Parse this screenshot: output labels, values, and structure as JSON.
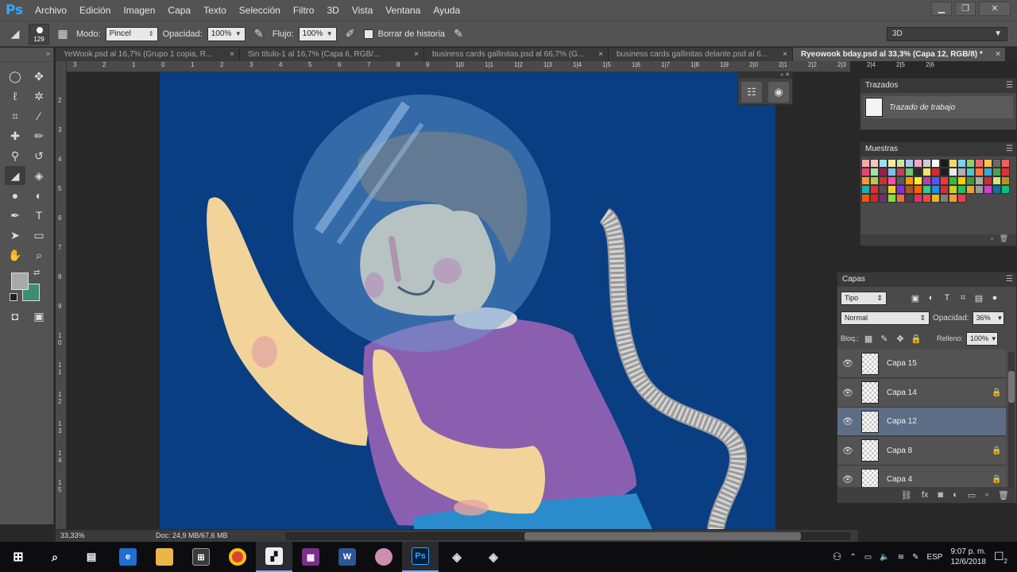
{
  "menu": {
    "logo": "Ps",
    "items": [
      "Archivo",
      "Edición",
      "Imagen",
      "Capa",
      "Texto",
      "Selección",
      "Filtro",
      "3D",
      "Vista",
      "Ventana",
      "Ayuda"
    ]
  },
  "window_controls": {
    "minimize": "▁",
    "restore": "❐",
    "close": "✕"
  },
  "options": {
    "brush_size": "129",
    "mode_label": "Modo:",
    "mode_value": "Pincel",
    "opacity_label": "Opacidad:",
    "opacity_value": "100%",
    "flow_label": "Flujo:",
    "flow_value": "100%",
    "erase_history_label": "Borrar de historia",
    "workspace": "3D"
  },
  "tabs": [
    {
      "label": "YeWook.psd al 16,7% (Grupo 1 copia, R...",
      "close": "×"
    },
    {
      "label": "Sin título-1 al 16,7% (Capa 6, RGB/...",
      "close": "×"
    },
    {
      "label": "business cards gallinitas.psd al 66,7% (G...",
      "close": "×"
    },
    {
      "label": "business cards gallinitas delante.psd al 6...",
      "close": "×"
    },
    {
      "label": "Ryeowook bday.psd al 33,3% (Capa 12, RGB/8) *",
      "close": "×"
    }
  ],
  "ruler_top": [
    "3",
    "2",
    "1",
    "0",
    "1",
    "2",
    "3",
    "4",
    "5",
    "6",
    "7",
    "8",
    "9",
    "1|0",
    "1|1",
    "1|2",
    "1|3",
    "1|4",
    "1|5",
    "1|6",
    "1|7",
    "1|8",
    "1|9",
    "2|0",
    "2|1",
    "2|2",
    "2|3",
    "2|4",
    "2|5",
    "2|6"
  ],
  "ruler_left": [
    "2",
    "3",
    "4",
    "5",
    "6",
    "7",
    "8",
    "9",
    "1 0",
    "1 1",
    "1 2",
    "1 3",
    "1 4",
    "1 5"
  ],
  "status": {
    "zoom": "33,33%",
    "doc": "Doc: 24,9 MB/67,6 MB"
  },
  "paths_panel": {
    "title": "Trazados",
    "item": "Trazado de trabajo"
  },
  "swatches_panel": {
    "title": "Muestras",
    "colors": [
      "#f9a8a8",
      "#f5c4c4",
      "#9fe0f0",
      "#f7ec9c",
      "#c7e79f",
      "#a9c7ef",
      "#f3a4c9",
      "#cfcfcf",
      "#ffffff",
      "#1a1a1a",
      "#f6d86a",
      "#7fd0f2",
      "#8ad36b",
      "#f26b6b",
      "#ffc14d",
      "#6a6a6a",
      "#f06060",
      "#e64578",
      "#a3e3a0",
      "#9b1c4d",
      "#77c2e0",
      "#cc3b5b",
      "#70c96a",
      "#2b2b2b",
      "#f2e66a",
      "#d32a2a",
      "#1e1e1e",
      "#e9e9e9",
      "#b0b0b0",
      "#4bc7c7",
      "#ff7a3d",
      "#3aa5d9",
      "#4da34d",
      "#dd3333",
      "#ff9933",
      "#b7c94b",
      "#cf3030",
      "#ff4fa3",
      "#5a5a5a",
      "#ff9b00",
      "#ffee22",
      "#c43aa8",
      "#5555ff",
      "#ff3333",
      "#33bb33",
      "#ffcc00",
      "#3d9c3d",
      "#aaaaaa",
      "#cc2e2e",
      "#cbe87a",
      "#c09020",
      "#1ab0b0",
      "#e03030",
      "#505050",
      "#f0d030",
      "#8a2be2",
      "#a05a2c",
      "#ff6600",
      "#33cc88",
      "#2a8adf",
      "#cc3333",
      "#cccc33",
      "#20c060",
      "#e8a33a",
      "#9a9a9a",
      "#d040d0",
      "#1070a0",
      "#10c080",
      "#ff5500",
      "#e02020",
      "#703070",
      "#80e040",
      "#ef6f3c",
      "#444444",
      "#e83060",
      "#ff4444",
      "#e8b820",
      "#7f7f7f",
      "#f0a030",
      "#ef3b4f"
    ]
  },
  "layers_panel": {
    "title": "Capas",
    "filter": "Tipo",
    "blend": "Normal",
    "opacity_label": "Opacidad:",
    "opacity_value": "36%",
    "lock_label": "Bloq.:",
    "fill_label": "Relleno:",
    "fill_value": "100%",
    "layers": [
      {
        "name": "Capa 15",
        "locked": false,
        "selected": false
      },
      {
        "name": "Capa 14",
        "locked": true,
        "selected": false
      },
      {
        "name": "Capa 12",
        "locked": false,
        "selected": true
      },
      {
        "name": "Capa 8",
        "locked": true,
        "selected": false
      },
      {
        "name": "Capa 4",
        "locked": true,
        "selected": false
      }
    ]
  },
  "taskbar": {
    "language": "ESP",
    "time": "9:07 p. m.",
    "date": "12/6/2018",
    "notifications": "2"
  },
  "colors": {
    "canvas_bg": "#0a3e82",
    "foreground": "#a9a9a9",
    "background": "#3b8f6e",
    "selection": "#5e6d86"
  }
}
